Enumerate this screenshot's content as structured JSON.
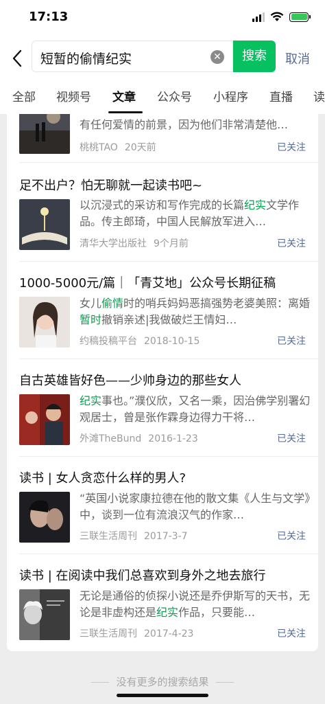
{
  "status": {
    "time": "17:13"
  },
  "search": {
    "query": "短暂的偷情纪实",
    "button": "搜索",
    "cancel": "取消"
  },
  "tabs": [
    "全部",
    "视频号",
    "文章",
    "公众号",
    "小程序",
    "直播",
    "读"
  ],
  "active_tab": "文章",
  "accent_color": "#07c160",
  "link_color": "#576b95",
  "results": [
    {
      "snippet_parts": [
        {
          "t": "有任何爱情的前景，因为他们非常清楚他…",
          "h": false
        }
      ],
      "source": "桃桃TAO",
      "date": "20天前",
      "follow": "已关注"
    },
    {
      "title": "足不出户？怕无聊就一起读书吧~",
      "snippet_parts": [
        {
          "t": "以沉浸式的采访和写作完成的长篇",
          "h": false
        },
        {
          "t": "纪实",
          "h": true
        },
        {
          "t": "文学作品。传主郎琦，中国人民解放军进入…",
          "h": false
        }
      ],
      "source": "清华大学出版社",
      "date": "9个月前",
      "follow": "已关注"
    },
    {
      "title": "1000-5000元/篇｜「青艾地」公众号长期征稿",
      "snippet_parts": [
        {
          "t": "女儿",
          "h": false
        },
        {
          "t": "偷情",
          "h": true
        },
        {
          "t": "时的哨兵妈妈恶搞强势老婆美照：离婚",
          "h": false
        },
        {
          "t": "暂时",
          "h": true
        },
        {
          "t": "撤销亲述|我做破烂王情妇…",
          "h": false
        }
      ],
      "source": "约稿投稿平台",
      "date": "2018-10-15",
      "follow": "已关注"
    },
    {
      "title": "自古英雄皆好色——少帅身边的那些女人",
      "snippet_parts": [
        {
          "t": "纪实",
          "h": true
        },
        {
          "t": "事也。”濮仪欣，又名一乘，因治佛学别署幻观居士，曾是张作霖身边得力干将…",
          "h": false
        }
      ],
      "source": "外滩TheBund",
      "date": "2016-1-23",
      "follow": "已关注"
    },
    {
      "title": "读书 | 女人贪恋什么样的男人?",
      "snippet_parts": [
        {
          "t": "“英国小说家康拉德在他的散文集《人生与文学》中，谈到一位有流浪汉气的作家…",
          "h": false
        }
      ],
      "source": "三联生活周刊",
      "date": "2017-3-7",
      "follow": "已关注"
    },
    {
      "title": "读书 | 在阅读中我们总喜欢到身外之地去旅行",
      "snippet_parts": [
        {
          "t": "无论是通俗的侦探小说还是乔伊斯写的天书，无论是非虚构还是",
          "h": false
        },
        {
          "t": "纪实",
          "h": true
        },
        {
          "t": "作品，只要能…",
          "h": false
        }
      ],
      "source": "三联生活周刊",
      "date": "2017-4-23",
      "follow": "已关注"
    }
  ],
  "footer": {
    "no_more": "没有更多的搜索结果"
  }
}
